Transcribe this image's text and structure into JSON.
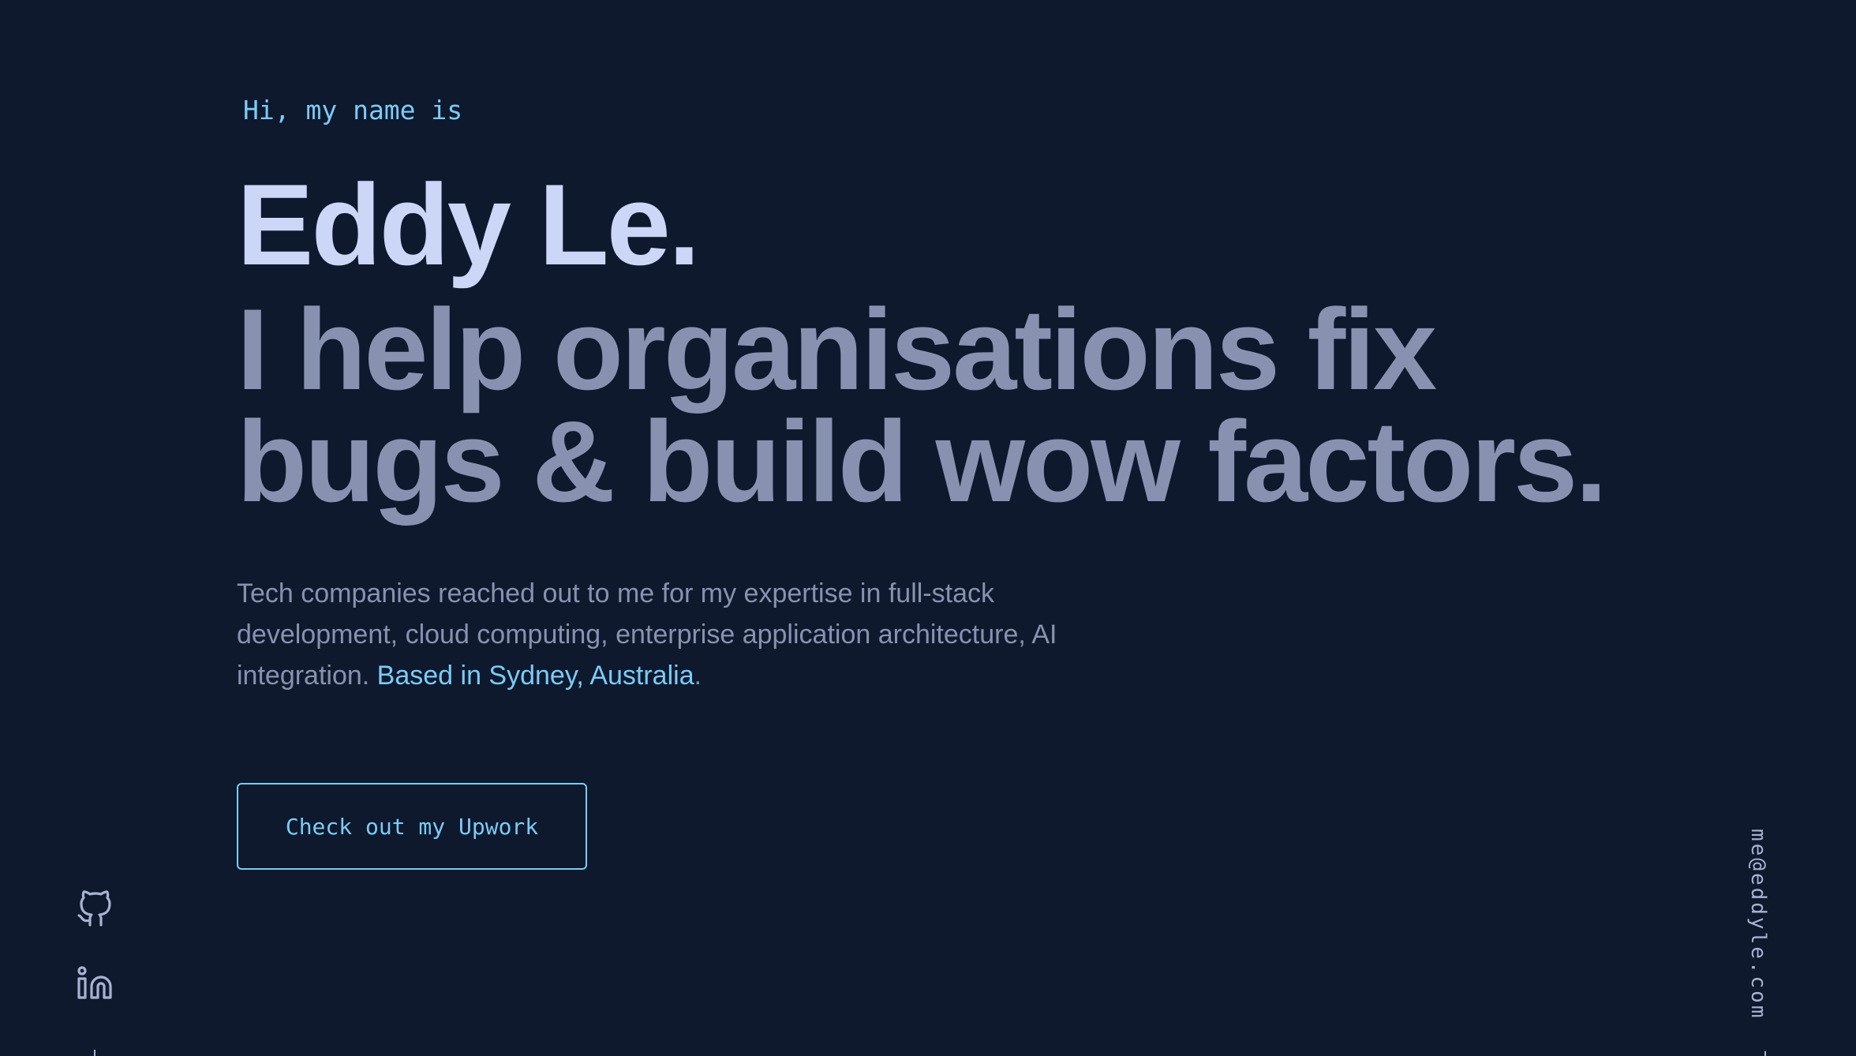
{
  "hero": {
    "greeting": "Hi, my name is",
    "name": "Eddy Le.",
    "tagline_line1": "I help organisations fix",
    "tagline_line2": "bugs & build wow factors.",
    "bio_line1": "Tech companies reached out to me for my expertise in full-stack",
    "bio_line2": "development, cloud computing, enterprise application architecture, AI",
    "bio_line3_prefix": "integration. ",
    "bio_location_link": "Based in Sydney, Australia",
    "bio_line3_suffix": ".",
    "cta_label": "Check out my Upwork"
  },
  "social": {
    "items": [
      {
        "icon": "github-icon"
      },
      {
        "icon": "linkedin-icon"
      }
    ]
  },
  "contact": {
    "email": "me@eddyle.com"
  },
  "colors": {
    "background": "#0e192d",
    "accent": "#7ccbf6",
    "heading": "#ccd6f6",
    "muted": "#8892b0"
  }
}
